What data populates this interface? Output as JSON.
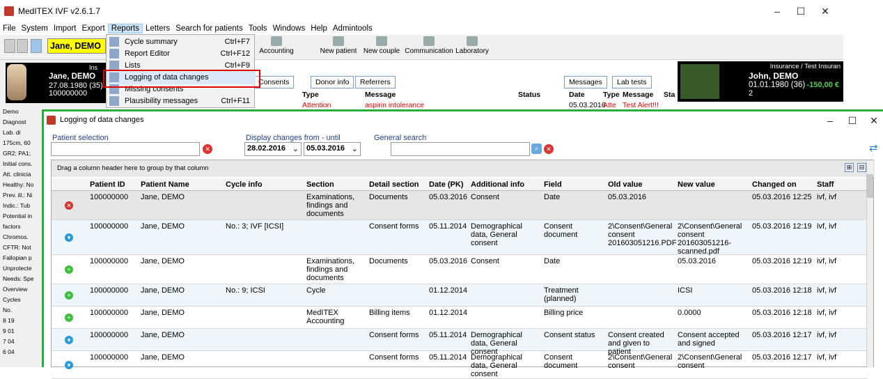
{
  "app": {
    "title": "MedITEX IVF v2.6.1.7",
    "patient_name": "Jane, DEMO"
  },
  "menu": [
    "File",
    "System",
    "Import",
    "Export",
    "Reports",
    "Letters",
    "Search for patients",
    "Tools",
    "Windows",
    "Help",
    "Admintools"
  ],
  "toolbar": {
    "accounting": "Accounting",
    "new_patient": "New patient",
    "new_couple": "New couple",
    "communication": "Communication",
    "laboratory": "Laboratory"
  },
  "reports_menu": [
    {
      "label": "Cycle summary",
      "shortcut": "Ctrl+F7"
    },
    {
      "label": "Report Editor",
      "shortcut": "Ctrl+F12"
    },
    {
      "label": "Lists",
      "shortcut": "Ctrl+F9"
    },
    {
      "label": "Logging of data changes",
      "shortcut": ""
    },
    {
      "label": "Missing consents",
      "shortcut": ""
    },
    {
      "label": "Plausibility messages",
      "shortcut": "Ctrl+F11"
    }
  ],
  "left_card": {
    "name": "Jane, DEMO",
    "dob": "27.08.1980 (35)",
    "id": "100000000",
    "ins": "Ins"
  },
  "right_card": {
    "name": "John, DEMO",
    "dob": "01.01.1980 (36)",
    "id": "2",
    "amount": "-150,00 €",
    "insurance": "Insurance / Test Insuran"
  },
  "bg_tabs": [
    "Consents",
    "Donor info",
    "Referrers",
    "Messages",
    "Lab tests"
  ],
  "bg_cols": {
    "type": "Type",
    "message": "Message",
    "status": "Status",
    "date": "Date",
    "type2": "Type",
    "message2": "Message",
    "st": "Sta"
  },
  "bg_row": {
    "type": "Attention",
    "message": "aspirin intolerance",
    "date": "05.03.2016",
    "type2": "Atte",
    "message2": "Test Alert!!!"
  },
  "side_text": [
    "Demo",
    "Diagnost",
    "Lab. di",
    "175cm, 60",
    "GR2; PA1;",
    "Initial cons.",
    "Att. clinicia",
    "Healthy: No",
    "Prev. ill.: Ni",
    "Indic.: Tub",
    "Potential in",
    "factors",
    "Chromos.",
    "CFTR: Not",
    "Fallopian p",
    "Unprotecte",
    "Needs: Spe",
    "Overview",
    "Cycles",
    "No.",
    "8 19",
    "9 01",
    "7 04",
    "6 04"
  ],
  "dialog": {
    "title": "Logging of data changes",
    "patient_selection": "Patient selection",
    "display_changes": "Display changes from - until",
    "date_from": "28.02.2016",
    "date_until": "05.03.2016",
    "general_search": "General search",
    "group_hint": "Drag a column header here to group by that column"
  },
  "columns": [
    "Patient ID",
    "Patient Name",
    "Cycle info",
    "Section",
    "Detail section",
    "Date (PK)",
    "Additional info",
    "Field",
    "Old value",
    "New value",
    "Changed on",
    "Staff"
  ],
  "rows": [
    {
      "icon": "delete",
      "cells": [
        "100000000",
        "Jane, DEMO",
        "",
        "Examinations, findings and documents",
        "Documents",
        "05.03.2016",
        "Consent",
        "Date",
        "05.03.2016",
        "",
        "05.03.2016 12:25",
        "ivf, ivf"
      ]
    },
    {
      "icon": "edit",
      "cells": [
        "100000000",
        "Jane, DEMO",
        "No.: 3;  IVF [ICSI]",
        "",
        "Consent forms",
        "05.11.2014",
        "Demographical data, General consent",
        "Consent document",
        "2\\Consent\\General consent 201603051216.PDF",
        "2\\Consent\\General consent 201603051216-scanned.pdf",
        "05.03.2016 12:19",
        "ivf, ivf"
      ]
    },
    {
      "icon": "add",
      "cells": [
        "100000000",
        "Jane, DEMO",
        "",
        "Examinations, findings and documents",
        "Documents",
        "05.03.2016",
        "Consent",
        "Date",
        "",
        "05.03.2016",
        "05.03.2016 12:19",
        "ivf, ivf"
      ]
    },
    {
      "icon": "add",
      "cells": [
        "100000000",
        "Jane, DEMO",
        "No.: 9;  ICSI",
        "Cycle",
        "",
        "01.12.2014",
        "",
        "Treatment (planned)",
        "",
        "ICSI",
        "05.03.2016 12:18",
        "ivf, ivf"
      ]
    },
    {
      "icon": "add",
      "cells": [
        "100000000",
        "Jane, DEMO",
        "",
        "MedITEX Accounting",
        "Billing items",
        "01.12.2014",
        "",
        "Billing price",
        "",
        "0.0000",
        "05.03.2016 12:18",
        "ivf, ivf"
      ]
    },
    {
      "icon": "edit",
      "cells": [
        "100000000",
        "Jane, DEMO",
        "",
        "",
        "Consent forms",
        "05.11.2014",
        "Demographical data, General consent",
        "Consent status",
        "Consent created and given to patient",
        "Consent accepted and signed",
        "05.03.2016 12:17",
        "ivf, ivf"
      ]
    },
    {
      "icon": "edit",
      "cells": [
        "100000000",
        "Jane, DEMO",
        "",
        "",
        "Consent forms",
        "05.11.2014",
        "Demographical data, General consent",
        "Consent document",
        "2\\Consent\\General consent",
        "2\\Consent\\General consent",
        "05.03.2016 12:17",
        "ivf, ivf"
      ]
    }
  ],
  "colors": {
    "highlight_border": "#e00000",
    "dialog_border": "#27ae3c",
    "add": "#3fbf3f",
    "edit": "#2a9bd8",
    "delete": "#d33333"
  }
}
